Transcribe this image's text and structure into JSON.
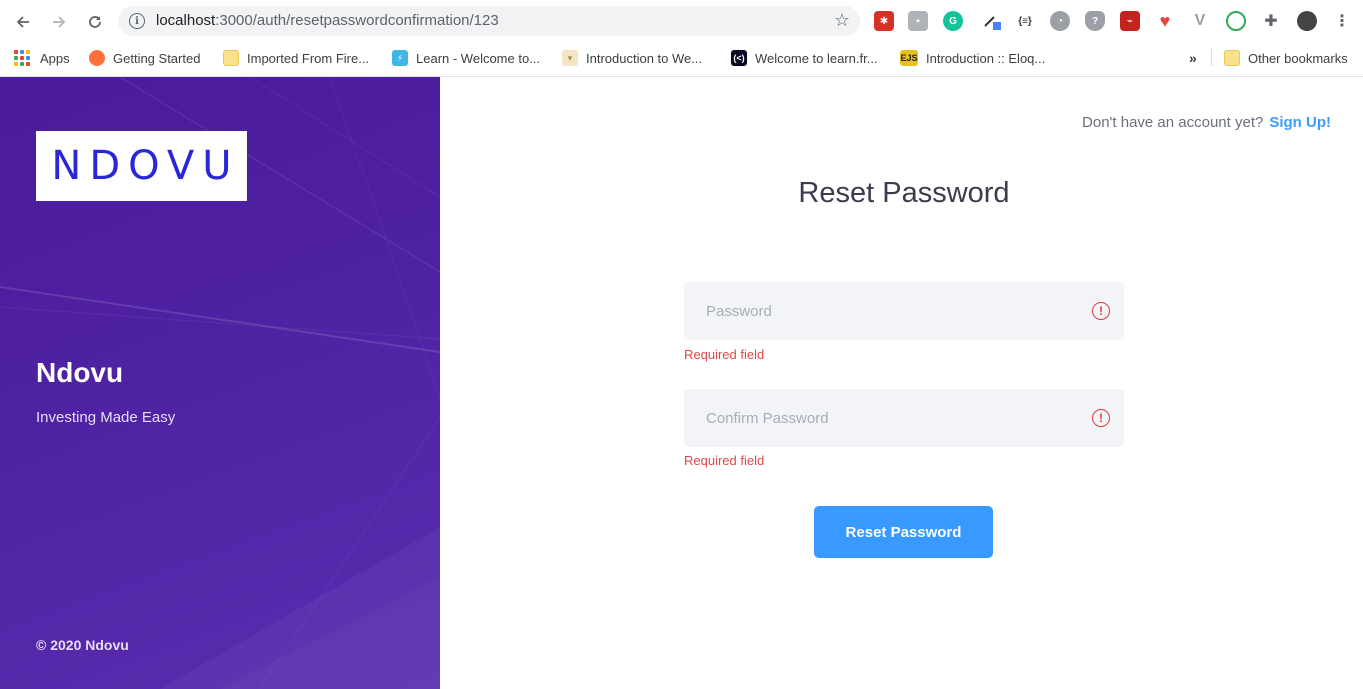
{
  "browser": {
    "url_host": "localhost",
    "url_path": ":3000/auth/resetpasswordconfirmation/123",
    "bookmarks": [
      {
        "label": "Apps",
        "icon": "apps-grid-icon"
      },
      {
        "label": "Getting Started",
        "icon": "firefox-icon"
      },
      {
        "label": "Imported From Fire...",
        "icon": "folder-icon"
      },
      {
        "label": "Learn - Welcome to...",
        "icon": "bolt-icon"
      },
      {
        "label": "Introduction to We...",
        "icon": "shield-icon"
      },
      {
        "label": "Welcome to learn.fr...",
        "icon": "fcc-icon"
      },
      {
        "label": "Introduction :: Eloq...",
        "icon": "ejs-icon"
      }
    ],
    "overflow_label": "»",
    "other_bookmarks": "Other bookmarks",
    "ejs_badge": "EJS",
    "json_ext": "{≡}"
  },
  "brand": {
    "logo_text": "NDOVU",
    "name": "Ndovu",
    "tagline": "Investing Made Easy",
    "copyright": "© 2020 Ndovu"
  },
  "header": {
    "signup_prompt": "Don't have an account yet?",
    "signup_link": "Sign Up!"
  },
  "form": {
    "title": "Reset Password",
    "password_placeholder": "Password",
    "password_error": "Required field",
    "confirm_placeholder": "Confirm Password",
    "confirm_error": "Required field",
    "submit_label": "Reset Password"
  },
  "colors": {
    "panel": "#4f22a3",
    "accent": "#3899fe",
    "error": "#e04848",
    "logo": "#2b27d9"
  }
}
